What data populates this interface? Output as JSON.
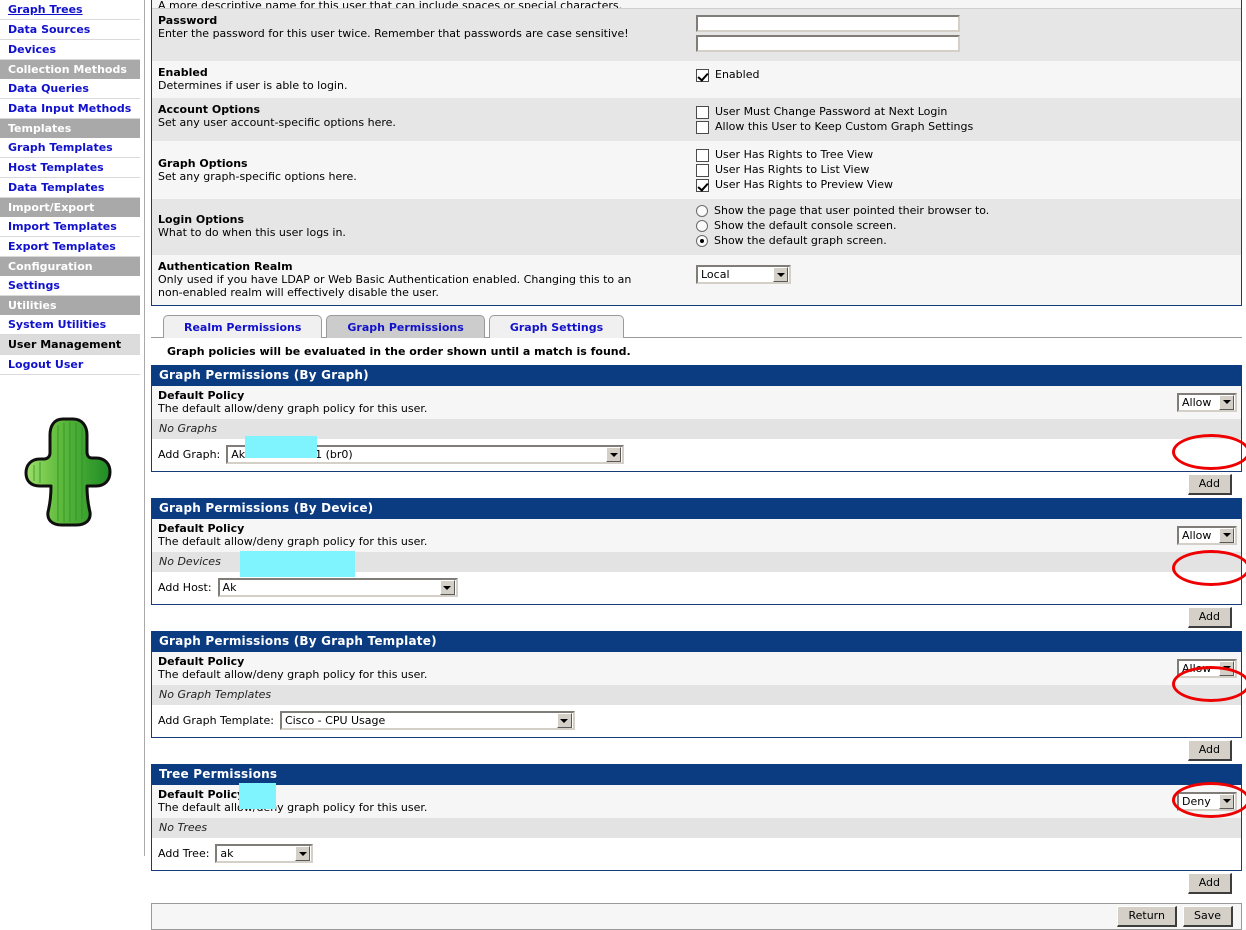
{
  "sidebar": {
    "items": [
      {
        "label": "Graph Trees",
        "type": "link",
        "name": "sidebar-item-graph-trees"
      },
      {
        "label": "Data Sources",
        "type": "link",
        "name": "sidebar-item-data-sources"
      },
      {
        "label": "Devices",
        "type": "link",
        "name": "sidebar-item-devices"
      },
      {
        "label": "Collection Methods",
        "type": "header",
        "name": "sidebar-header-collection-methods"
      },
      {
        "label": "Data Queries",
        "type": "link",
        "name": "sidebar-item-data-queries"
      },
      {
        "label": "Data Input Methods",
        "type": "link",
        "name": "sidebar-item-data-input-methods"
      },
      {
        "label": "Templates",
        "type": "header",
        "name": "sidebar-header-templates"
      },
      {
        "label": "Graph Templates",
        "type": "link",
        "name": "sidebar-item-graph-templates"
      },
      {
        "label": "Host Templates",
        "type": "link",
        "name": "sidebar-item-host-templates"
      },
      {
        "label": "Data Templates",
        "type": "link",
        "name": "sidebar-item-data-templates"
      },
      {
        "label": "Import/Export",
        "type": "header",
        "name": "sidebar-header-import-export"
      },
      {
        "label": "Import Templates",
        "type": "link",
        "name": "sidebar-item-import-templates"
      },
      {
        "label": "Export Templates",
        "type": "link",
        "name": "sidebar-item-export-templates"
      },
      {
        "label": "Configuration",
        "type": "header",
        "name": "sidebar-header-configuration"
      },
      {
        "label": "Settings",
        "type": "link",
        "name": "sidebar-item-settings"
      },
      {
        "label": "Utilities",
        "type": "header",
        "name": "sidebar-header-utilities"
      },
      {
        "label": "System Utilities",
        "type": "link",
        "name": "sidebar-item-system-utilities"
      },
      {
        "label": "User Management",
        "type": "selected",
        "name": "sidebar-item-user-management"
      },
      {
        "label": "Logout User",
        "type": "link",
        "name": "sidebar-item-logout-user"
      }
    ],
    "logo_icon": "cactus-logo-icon"
  },
  "form": {
    "cut_off_row_text": "A more descriptive name for this user that can include spaces or special characters.",
    "password": {
      "title": "Password",
      "desc": "Enter the password for this user twice. Remember that passwords are case sensitive!",
      "value1": "",
      "value2": ""
    },
    "enabled": {
      "title": "Enabled",
      "desc": "Determines if user is able to login.",
      "checkbox_label": "Enabled",
      "checked": true
    },
    "account_options": {
      "title": "Account Options",
      "desc": "Set any user account-specific options here.",
      "options": [
        {
          "label": "User Must Change Password at Next Login",
          "checked": false
        },
        {
          "label": "Allow this User to Keep Custom Graph Settings",
          "checked": false
        }
      ]
    },
    "graph_options": {
      "title": "Graph Options",
      "desc": "Set any graph-specific options here.",
      "options": [
        {
          "label": "User Has Rights to Tree View",
          "checked": false
        },
        {
          "label": "User Has Rights to List View",
          "checked": false
        },
        {
          "label": "User Has Rights to Preview View",
          "checked": true
        }
      ]
    },
    "login_options": {
      "title": "Login Options",
      "desc": "What to do when this user logs in.",
      "options": [
        {
          "label": "Show the page that user pointed their browser to.",
          "selected": false
        },
        {
          "label": "Show the default console screen.",
          "selected": false
        },
        {
          "label": "Show the default graph screen.",
          "selected": true
        }
      ]
    },
    "auth_realm": {
      "title": "Authentication Realm",
      "desc_line1": "Only used if you have LDAP or Web Basic Authentication enabled. Changing this to an",
      "desc_line2": "non-enabled realm will effectively disable the user.",
      "value": "Local"
    }
  },
  "tabs": [
    {
      "label": "Realm Permissions",
      "active": false
    },
    {
      "label": "Graph Permissions",
      "active": true
    },
    {
      "label": "Graph Settings",
      "active": false
    }
  ],
  "policy_note": "Graph policies will be evaluated in the order shown until a match is found.",
  "sections": [
    {
      "header": "Graph Permissions (By Graph)",
      "policy_title": "Default Policy",
      "policy_desc": "The default allow/deny graph policy for this user.",
      "policy_value": "Allow",
      "empty_text": "No Graphs",
      "add_label": "Add Graph:",
      "add_value": "Ak                · 192.168.1.1 (br0)",
      "add_select_width": 398,
      "add_button": "Add",
      "highlighted": true
    },
    {
      "header": "Graph Permissions (By Device)",
      "policy_title": "Default Policy",
      "policy_desc": "The default allow/deny graph policy for this user.",
      "policy_value": "Allow",
      "empty_text": "No Devices",
      "add_label": "Add Host:",
      "add_value": "Ak",
      "add_select_width": 240,
      "add_button": "Add",
      "highlighted": true
    },
    {
      "header": "Graph Permissions (By Graph Template)",
      "policy_title": "Default Policy",
      "policy_desc": "The default allow/deny graph policy for this user.",
      "policy_value": "Allow",
      "empty_text": "No Graph Templates",
      "add_label": "Add Graph Template:",
      "add_value": "Cisco - CPU Usage",
      "add_select_width": 295,
      "add_button": "Add",
      "highlighted": true
    },
    {
      "header": "Tree Permissions",
      "policy_title": "Default Policy",
      "policy_desc": "The default allow/deny graph policy for this user.",
      "policy_value": "Deny",
      "empty_text": "No Trees",
      "add_label": "Add Tree:",
      "add_value": "ak",
      "add_select_width": 98,
      "add_button": "Add",
      "highlighted": true
    }
  ],
  "footer": {
    "return_label": "Return",
    "save_label": "Save"
  },
  "colors": {
    "section_header_bg": "#0b3c82",
    "sidebar_header_bg": "#a9a9a9",
    "link": "#1111cc",
    "annotation": "#ee0000",
    "redaction": "#7ff4ff"
  }
}
